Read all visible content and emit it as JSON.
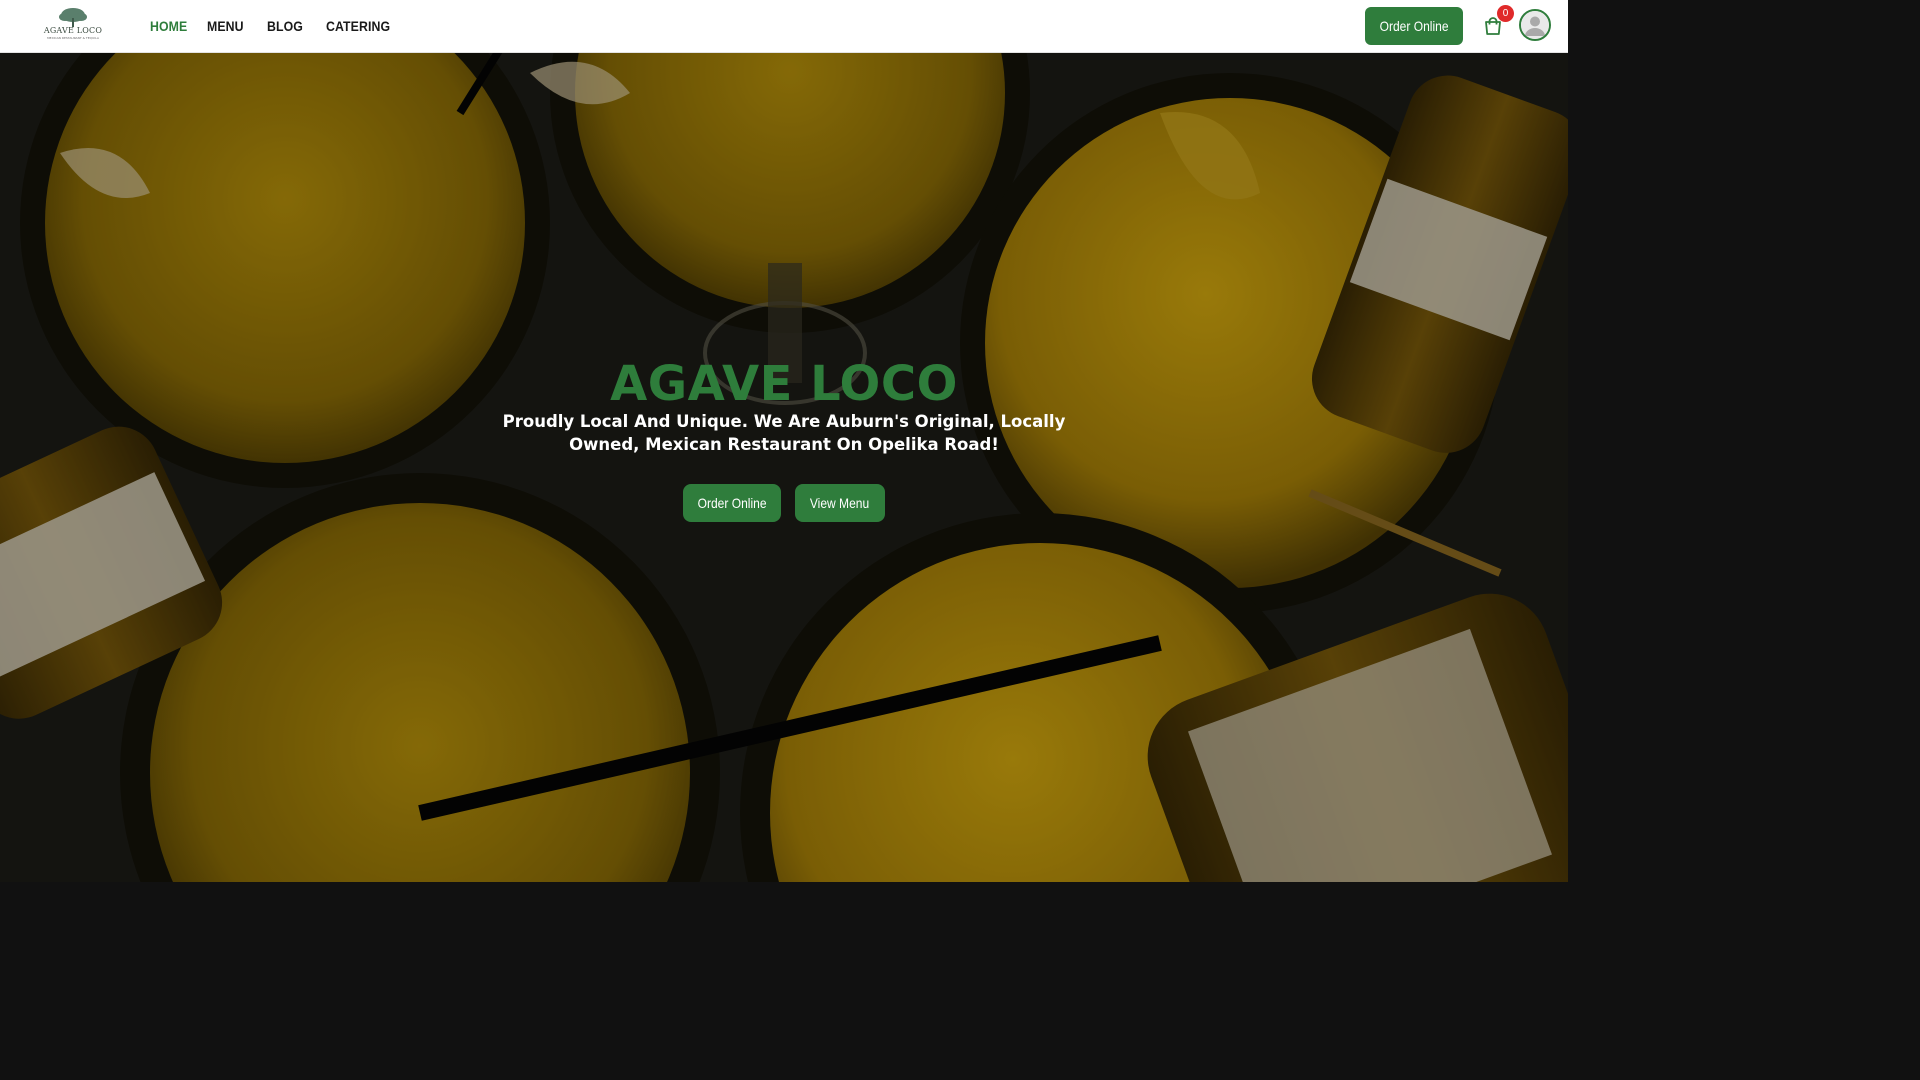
{
  "brand": {
    "logo_text": "AGAVE LOCO",
    "logo_subtext": "MEXICAN RESTAURANT & TEQUILA"
  },
  "nav": {
    "items": [
      {
        "label": "HOME",
        "active": true
      },
      {
        "label": "MENU",
        "active": false
      },
      {
        "label": "BLOG",
        "active": false
      },
      {
        "label": "CATERING",
        "active": false
      }
    ]
  },
  "header": {
    "order_button": "Order Online",
    "cart_count": "0",
    "icons": [
      "cart-icon",
      "user-avatar-icon"
    ]
  },
  "hero": {
    "title": "AGAVE LOCO",
    "subtitle": "Proudly Local And Unique. We Are Auburn's Original, Locally Owned, Mexican Restaurant On Opelika Road!",
    "primary_button": "Order Online",
    "secondary_button": "View Menu"
  },
  "colors": {
    "accent": "#2f7d3c",
    "badge": "#e02a2a",
    "header_bg": "#ffffff"
  }
}
